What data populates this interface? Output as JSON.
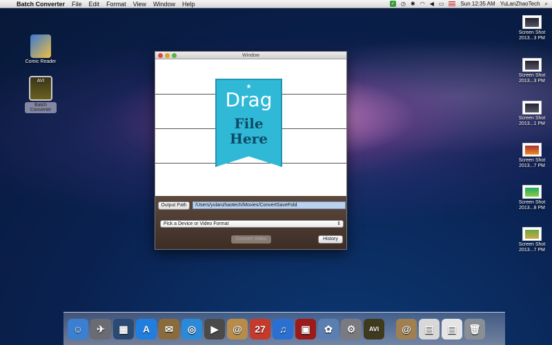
{
  "menubar": {
    "apple": "",
    "app_name": "Batch Converter",
    "menus": [
      "File",
      "Edit",
      "Format",
      "View",
      "Window",
      "Help"
    ],
    "clock": "Sun 12:35 AM",
    "user": "YuLanZhaoTech"
  },
  "desktop_left": [
    {
      "label": "Comic Reader",
      "icon": "comic-reader-icon"
    },
    {
      "label_line1": "Batch",
      "label_line2": "Converter",
      "icon": "batch-converter-icon"
    }
  ],
  "desktop_right": [
    {
      "l1": "Screen Shot",
      "l2": "2013...3 PM"
    },
    {
      "l1": "Screen Shot",
      "l2": "2013...3 PM"
    },
    {
      "l1": "Screen Shot",
      "l2": "2013...1 PM"
    },
    {
      "l1": "Screen Shot",
      "l2": "2013...7 PM"
    },
    {
      "l1": "Screen Shot",
      "l2": "2013...8 PM"
    },
    {
      "l1": "Screen Shot",
      "l2": "2013...7 PM"
    }
  ],
  "window": {
    "title": "Window",
    "drop_top": "Drag",
    "drop_bottom": "File Here",
    "output_label": "Output Path",
    "output_value": "/Users/yulanzhaotech/Movies/ConvertSaveFold",
    "format_placeholder": "Pick a Device or Video Format",
    "convert_label": "Convert Video",
    "history_label": "History"
  },
  "dock": {
    "items": [
      {
        "icon": "finder-icon",
        "glyph": "☺",
        "color": "#3a7fd0"
      },
      {
        "icon": "launchpad-icon",
        "glyph": "✈",
        "color": "#6b6b74"
      },
      {
        "icon": "mission-control-icon",
        "glyph": "▦",
        "color": "#2b4a73"
      },
      {
        "icon": "app-store-icon",
        "glyph": "A",
        "color": "#1f7ee0"
      },
      {
        "icon": "mail-stamp-icon",
        "glyph": "✉",
        "color": "#8a6b3b"
      },
      {
        "icon": "safari-icon",
        "glyph": "◎",
        "color": "#2b8ad8"
      },
      {
        "icon": "facetime-icon",
        "glyph": "▶",
        "color": "#4a4a4a"
      },
      {
        "icon": "address-book-icon",
        "glyph": "@",
        "color": "#b78c4a"
      },
      {
        "icon": "calendar-icon",
        "glyph": "27",
        "color": "#c63a2c"
      },
      {
        "icon": "itunes-icon",
        "glyph": "♫",
        "color": "#2a6fd1"
      },
      {
        "icon": "photo-booth-icon",
        "glyph": "▣",
        "color": "#9b1b1b"
      },
      {
        "icon": "iphoto-icon",
        "glyph": "✿",
        "color": "#5a7fb0"
      },
      {
        "icon": "system-preferences-icon",
        "glyph": "⚙",
        "color": "#7a7a80"
      },
      {
        "icon": "batch-converter-icon",
        "glyph": "AVI",
        "color": "#3f3a1e"
      },
      {
        "icon": "documents-stack-icon",
        "glyph": "@",
        "color": "#a08050"
      },
      {
        "icon": "downloads-stack-icon",
        "glyph": "▤",
        "color": "#d8d8d8"
      },
      {
        "icon": "file-stack-icon",
        "glyph": "▤",
        "color": "#e5e5e5"
      },
      {
        "icon": "trash-icon",
        "glyph": "🗑",
        "color": "#8a8f96"
      }
    ]
  },
  "colors": {
    "badge": "#2fb9d7",
    "controls_bg": "#4a3a30",
    "path_field": "#b9d2ee"
  }
}
